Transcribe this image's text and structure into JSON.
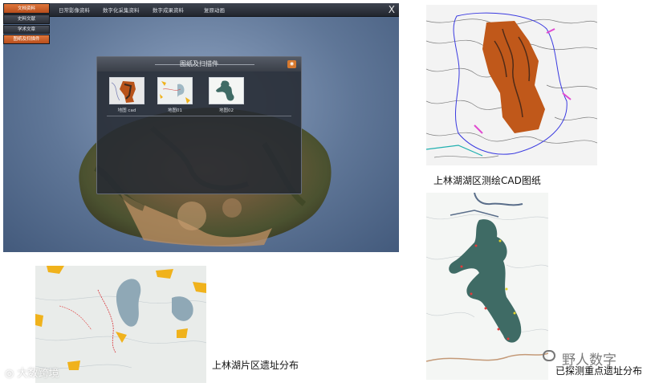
{
  "app": {
    "close_label": "X",
    "top_menu": [
      "日常影像资料",
      "数字化采集资料",
      "数字成果资料",
      "复原动画"
    ],
    "left_nav": [
      {
        "label": "文档资料",
        "active": true
      },
      {
        "label": "史料文献",
        "active": false
      },
      {
        "label": "学术文章",
        "active": false
      },
      {
        "label": "图纸及扫描件",
        "active": true
      }
    ]
  },
  "dialog": {
    "title": "图纸及扫描件",
    "items": [
      {
        "label": "地图 cad",
        "icon": "cad-map-thumbnail"
      },
      {
        "label": "地图01",
        "icon": "area-map-thumbnail"
      },
      {
        "label": "地图02",
        "icon": "sites-map-thumbnail"
      }
    ]
  },
  "captions": {
    "cad": "上林湖湖区测绘CAD图纸",
    "area": "上林湖片区遗址分布",
    "sites": "已探测重点遗址分布"
  },
  "watermarks": {
    "left": "大数跨境",
    "right": "野人数字"
  },
  "colors": {
    "accent_orange": "#d6792f",
    "topbar": "#2b2f37",
    "lake_teal": "#3f6b65",
    "cad_orange": "#c0581a"
  }
}
